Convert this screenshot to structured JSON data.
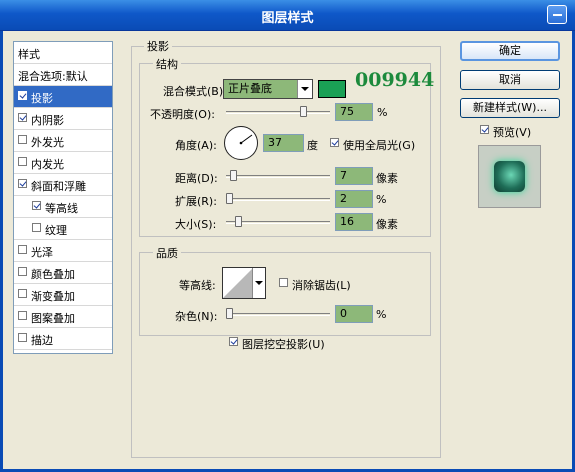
{
  "window": {
    "title": "图层样式"
  },
  "left_panel": {
    "header": "样式",
    "items": [
      {
        "label": "混合选项:默认",
        "checkbox": false,
        "checked": false,
        "selected": false,
        "indent": 0
      },
      {
        "label": "投影",
        "checkbox": true,
        "checked": true,
        "selected": true,
        "indent": 0
      },
      {
        "label": "内阴影",
        "checkbox": true,
        "checked": true,
        "selected": false,
        "indent": 0
      },
      {
        "label": "外发光",
        "checkbox": true,
        "checked": false,
        "selected": false,
        "indent": 0
      },
      {
        "label": "内发光",
        "checkbox": true,
        "checked": false,
        "selected": false,
        "indent": 0
      },
      {
        "label": "斜面和浮雕",
        "checkbox": true,
        "checked": true,
        "selected": false,
        "indent": 0
      },
      {
        "label": "等高线",
        "checkbox": true,
        "checked": true,
        "selected": false,
        "indent": 1
      },
      {
        "label": "纹理",
        "checkbox": true,
        "checked": false,
        "selected": false,
        "indent": 1
      },
      {
        "label": "光泽",
        "checkbox": true,
        "checked": false,
        "selected": false,
        "indent": 0
      },
      {
        "label": "颜色叠加",
        "checkbox": true,
        "checked": false,
        "selected": false,
        "indent": 0
      },
      {
        "label": "渐变叠加",
        "checkbox": true,
        "checked": false,
        "selected": false,
        "indent": 0
      },
      {
        "label": "图案叠加",
        "checkbox": true,
        "checked": false,
        "selected": false,
        "indent": 0
      },
      {
        "label": "描边",
        "checkbox": true,
        "checked": false,
        "selected": false,
        "indent": 0
      }
    ]
  },
  "shadow": {
    "section_title": "投影",
    "structure_title": "结构",
    "blend_mode_label": "混合模式(B):",
    "blend_mode_value": "正片叠底",
    "shadow_color": "#1aa055",
    "watermark_text": "009944",
    "watermark_color": "#1c8a3c",
    "opacity_label": "不透明度(O):",
    "opacity_value": "75",
    "opacity_unit": "%",
    "angle_label": "角度(A):",
    "angle_value": "37",
    "angle_unit": "度",
    "global_light_label": "使用全局光(G)",
    "global_light_checked": true,
    "distance_label": "距离(D):",
    "distance_value": "7",
    "distance_unit": "像素",
    "spread_label": "扩展(R):",
    "spread_value": "2",
    "spread_unit": "%",
    "size_label": "大小(S):",
    "size_value": "16",
    "size_unit": "像素"
  },
  "quality": {
    "title": "品质",
    "contour_label": "等高线:",
    "antialias_label": "消除锯齿(L)",
    "antialias_checked": false,
    "noise_label": "杂色(N):",
    "noise_value": "0",
    "noise_unit": "%",
    "knockout_label": "图层挖空投影(U)",
    "knockout_checked": true
  },
  "buttons": {
    "ok": "确定",
    "cancel": "取消",
    "new_style": "新建样式(W)...",
    "preview_label": "预览(V)",
    "preview_checked": true
  },
  "colors": {
    "field_bg": "#8db879",
    "selection": "#316ac5",
    "title_bar": "#0f58c9"
  }
}
